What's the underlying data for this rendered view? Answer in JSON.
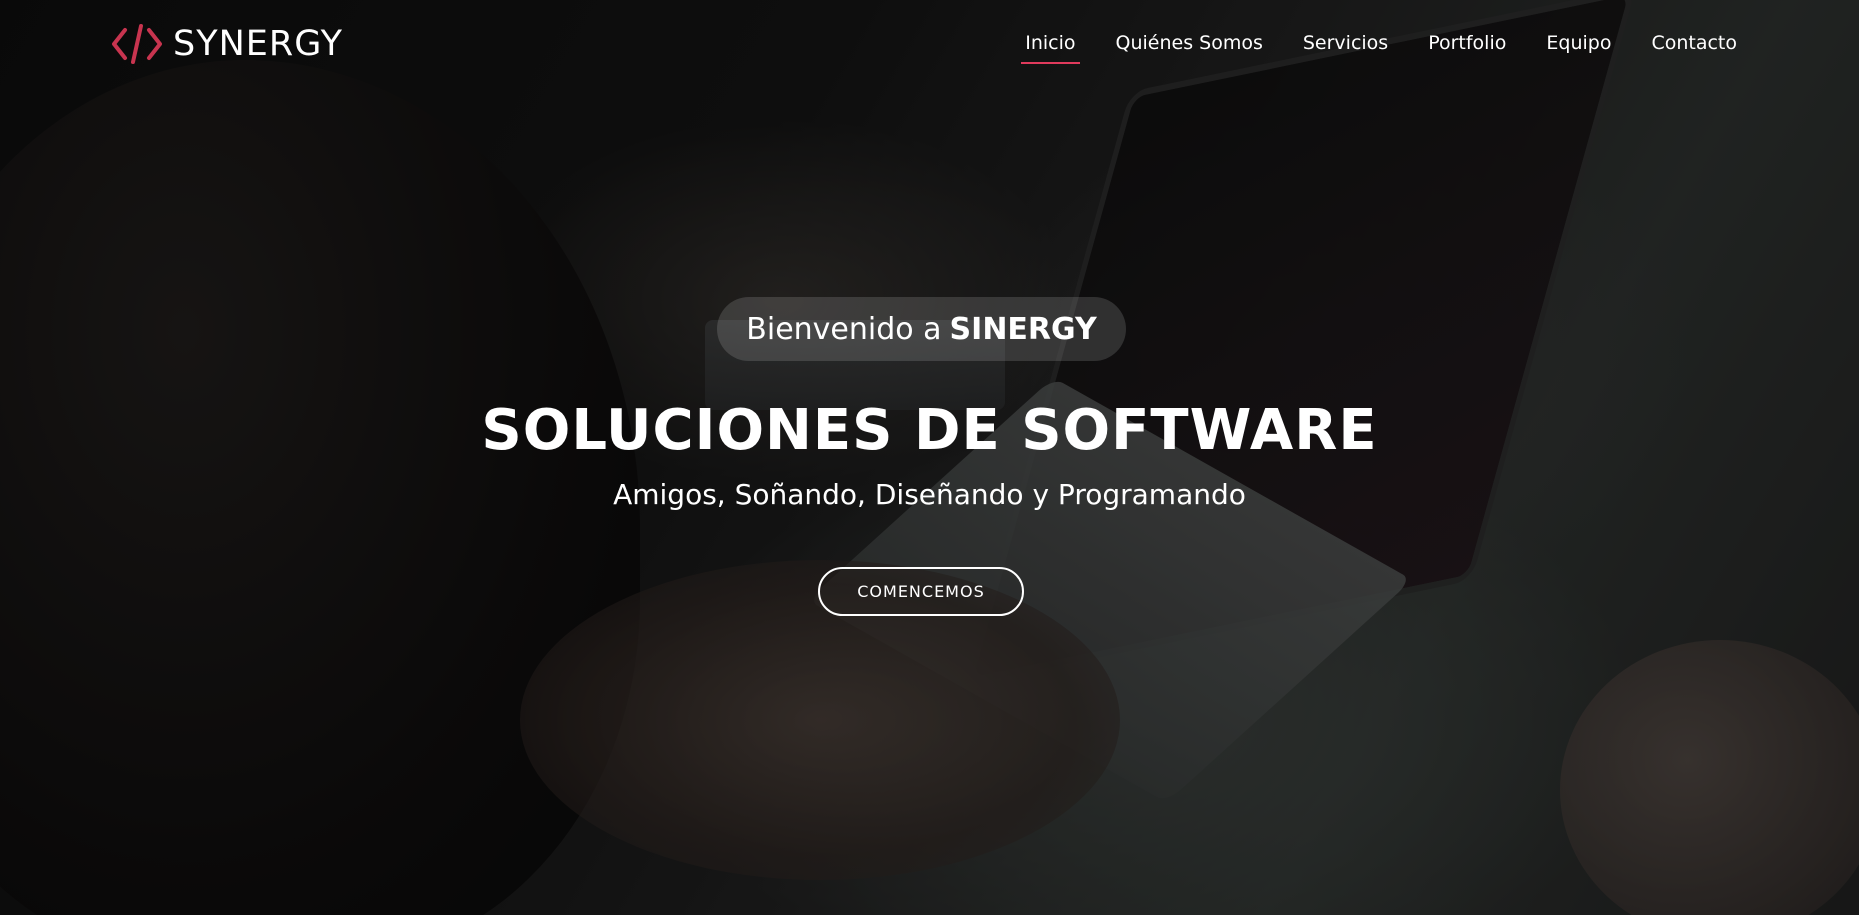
{
  "brand": {
    "logo_icon": "code-brackets-icon",
    "name": "SYNERGY",
    "accent_color": "#e03a5c"
  },
  "nav": {
    "items": [
      {
        "label": "Inicio",
        "active": true
      },
      {
        "label": "Quiénes Somos",
        "active": false
      },
      {
        "label": "Servicios",
        "active": false
      },
      {
        "label": "Portfolio",
        "active": false
      },
      {
        "label": "Equipo",
        "active": false
      },
      {
        "label": "Contacto",
        "active": false
      }
    ]
  },
  "hero": {
    "welcome_prefix": "Bienvenido a",
    "welcome_brand": "SINERGY",
    "title": "SOLUCIONES DE SOFTWARE",
    "subtitle": "Amigos, Soñando, Diseñando y Programando",
    "cta_label": "COMENCEMOS"
  }
}
